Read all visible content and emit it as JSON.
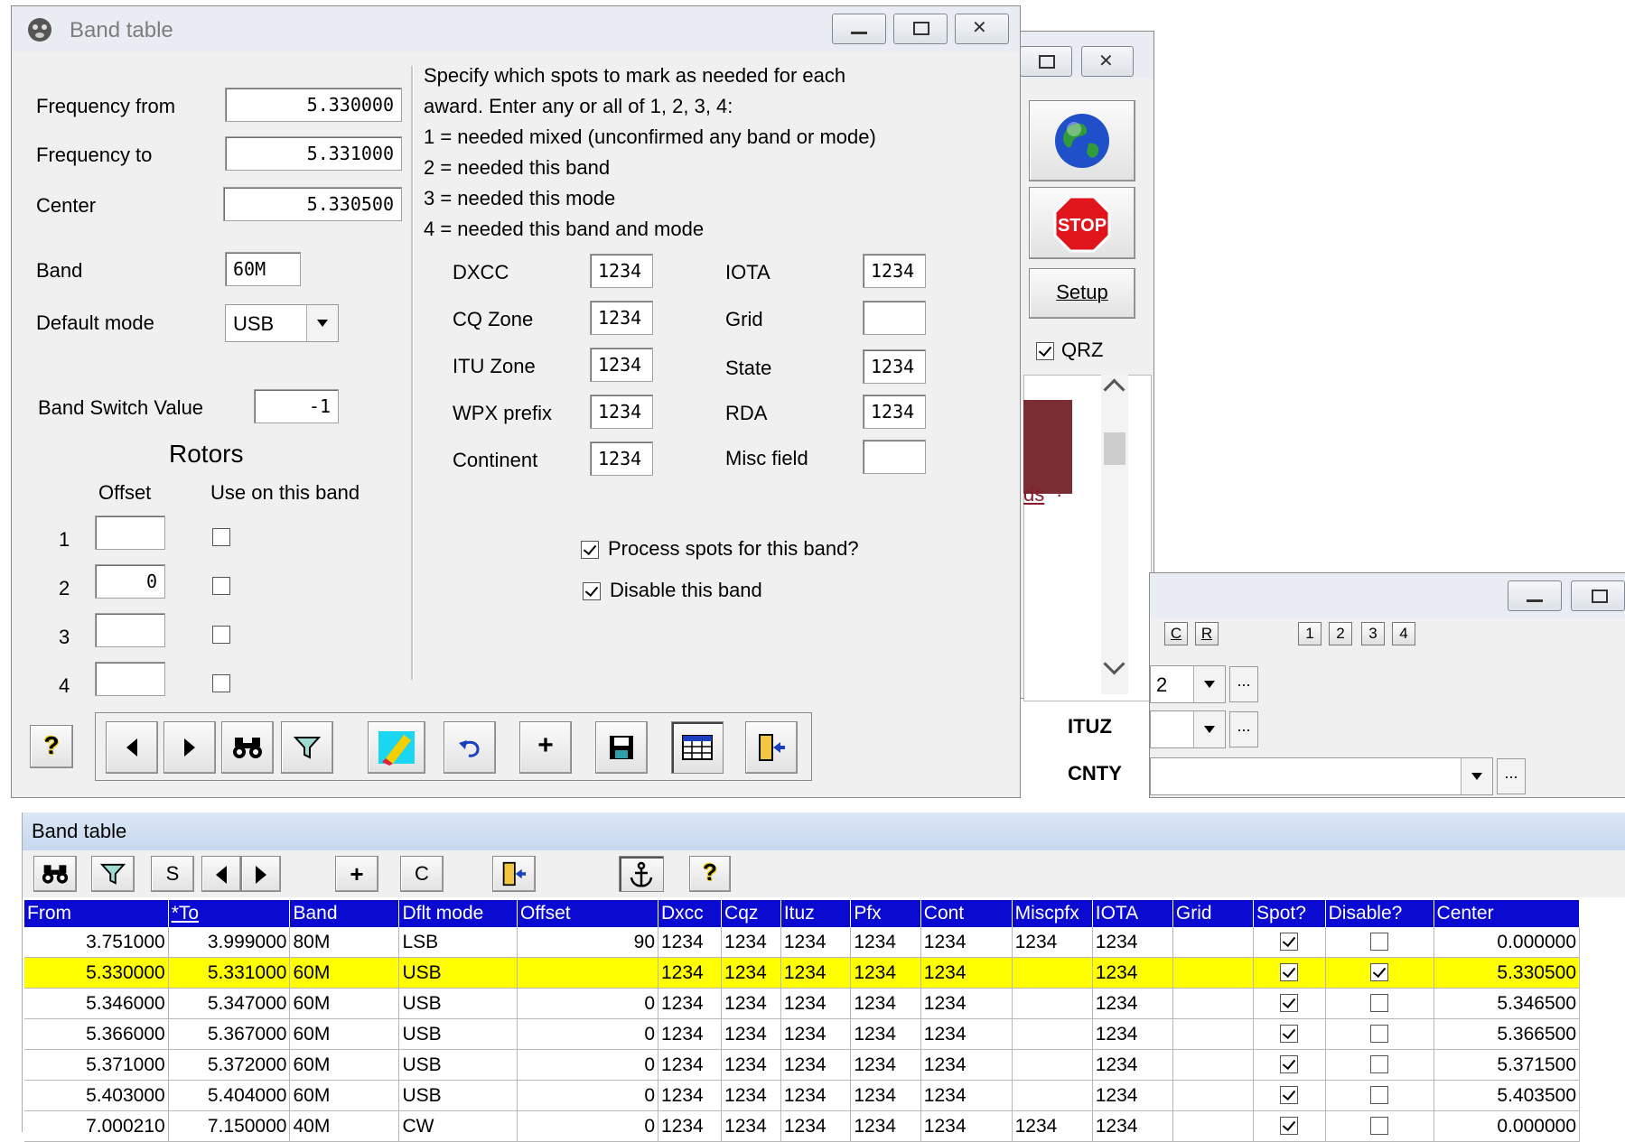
{
  "dialog": {
    "title": "Band table",
    "freq_from_label": "Frequency from",
    "freq_from": "5.330000",
    "freq_to_label": "Frequency to",
    "freq_to": "5.331000",
    "center_label": "Center",
    "center": "5.330500",
    "band_label": "Band",
    "band": "60M",
    "default_mode_label": "Default mode",
    "default_mode": "USB",
    "band_switch_label": "Band Switch Value",
    "band_switch": "-1",
    "rotors_title": "Rotors",
    "offset_header": "Offset",
    "use_header": "Use on this band",
    "rotors": [
      {
        "num": "1",
        "offset": ""
      },
      {
        "num": "2",
        "offset": "0"
      },
      {
        "num": "3",
        "offset": ""
      },
      {
        "num": "4",
        "offset": ""
      }
    ],
    "instructions": [
      "Specify which spots to mark as needed for each",
      "award.  Enter any or all of 1,  2,  3,  4:",
      "1 = needed mixed (unconfirmed any band or mode)",
      "2 = needed this band",
      "3 = needed this mode",
      "4 = needed this band and mode"
    ],
    "awards_left": [
      {
        "label": "DXCC",
        "value": "1234"
      },
      {
        "label": "CQ Zone",
        "value": "1234"
      },
      {
        "label": "ITU Zone",
        "value": "1234"
      },
      {
        "label": "WPX prefix",
        "value": "1234"
      },
      {
        "label": "Continent",
        "value": "1234"
      }
    ],
    "awards_right": [
      {
        "label": "IOTA",
        "value": "1234"
      },
      {
        "label": "Grid",
        "value": ""
      },
      {
        "label": "State",
        "value": "1234"
      },
      {
        "label": "RDA",
        "value": "1234"
      },
      {
        "label": "Misc field",
        "value": ""
      }
    ],
    "process_spots_label": "Process spots for this band?",
    "disable_label": "Disable this band",
    "help_glyph": "?"
  },
  "background": {
    "setup_label": "Setup",
    "qrz_label": "QRZ",
    "link_fragment": "ds",
    "btn_c": "C",
    "btn_r": "R",
    "num_buttons": [
      "1",
      "2",
      "3",
      "4"
    ],
    "combo_value": "2",
    "ituz_label": "ITUZ",
    "cnty_label": "CNTY",
    "dots": "..."
  },
  "grid": {
    "title": "Band table",
    "toolbar": {
      "s": "S",
      "c": "C",
      "help": "?"
    },
    "columns": [
      "From",
      "*To",
      "Band",
      "Dflt mode",
      "Offset",
      "Dxcc",
      "Cqz",
      "Ituz",
      "Pfx",
      "Cont",
      "Miscpfx",
      "IOTA",
      "Grid",
      "Spot?",
      "Disable?",
      "Center"
    ],
    "rows": [
      {
        "from": "3.751000",
        "to": "3.999000",
        "band": "80M",
        "mode": "LSB",
        "offset": "90",
        "dxcc": "1234",
        "cqz": "1234",
        "ituz": "1234",
        "pfx": "1234",
        "cont": "1234",
        "miscpfx": "1234",
        "iota": "1234",
        "grid": "",
        "spot": true,
        "disable": false,
        "center": "0.000000"
      },
      {
        "from": "5.330000",
        "to": "5.331000",
        "band": "60M",
        "mode": "USB",
        "offset": "",
        "dxcc": "1234",
        "cqz": "1234",
        "ituz": "1234",
        "pfx": "1234",
        "cont": "1234",
        "miscpfx": "",
        "iota": "1234",
        "grid": "",
        "spot": true,
        "disable": true,
        "center": "5.330500"
      },
      {
        "from": "5.346000",
        "to": "5.347000",
        "band": "60M",
        "mode": "USB",
        "offset": "0",
        "dxcc": "1234",
        "cqz": "1234",
        "ituz": "1234",
        "pfx": "1234",
        "cont": "1234",
        "miscpfx": "",
        "iota": "1234",
        "grid": "",
        "spot": true,
        "disable": false,
        "center": "5.346500"
      },
      {
        "from": "5.366000",
        "to": "5.367000",
        "band": "60M",
        "mode": "USB",
        "offset": "0",
        "dxcc": "1234",
        "cqz": "1234",
        "ituz": "1234",
        "pfx": "1234",
        "cont": "1234",
        "miscpfx": "",
        "iota": "1234",
        "grid": "",
        "spot": true,
        "disable": false,
        "center": "5.366500"
      },
      {
        "from": "5.371000",
        "to": "5.372000",
        "band": "60M",
        "mode": "USB",
        "offset": "0",
        "dxcc": "1234",
        "cqz": "1234",
        "ituz": "1234",
        "pfx": "1234",
        "cont": "1234",
        "miscpfx": "",
        "iota": "1234",
        "grid": "",
        "spot": true,
        "disable": false,
        "center": "5.371500"
      },
      {
        "from": "5.403000",
        "to": "5.404000",
        "band": "60M",
        "mode": "USB",
        "offset": "0",
        "dxcc": "1234",
        "cqz": "1234",
        "ituz": "1234",
        "pfx": "1234",
        "cont": "1234",
        "miscpfx": "",
        "iota": "1234",
        "grid": "",
        "spot": true,
        "disable": false,
        "center": "5.403500"
      },
      {
        "from": "7.000210",
        "to": "7.150000",
        "band": "40M",
        "mode": "CW",
        "offset": "0",
        "dxcc": "1234",
        "cqz": "1234",
        "ituz": "1234",
        "pfx": "1234",
        "cont": "1234",
        "miscpfx": "1234",
        "iota": "1234",
        "grid": "",
        "spot": true,
        "disable": false,
        "center": "0.000000"
      }
    ],
    "selected_row": 1
  },
  "colors": {
    "header_blue": "#0a0ad0",
    "selected_row": "#ffff00",
    "panel": "#f0f0f0"
  }
}
